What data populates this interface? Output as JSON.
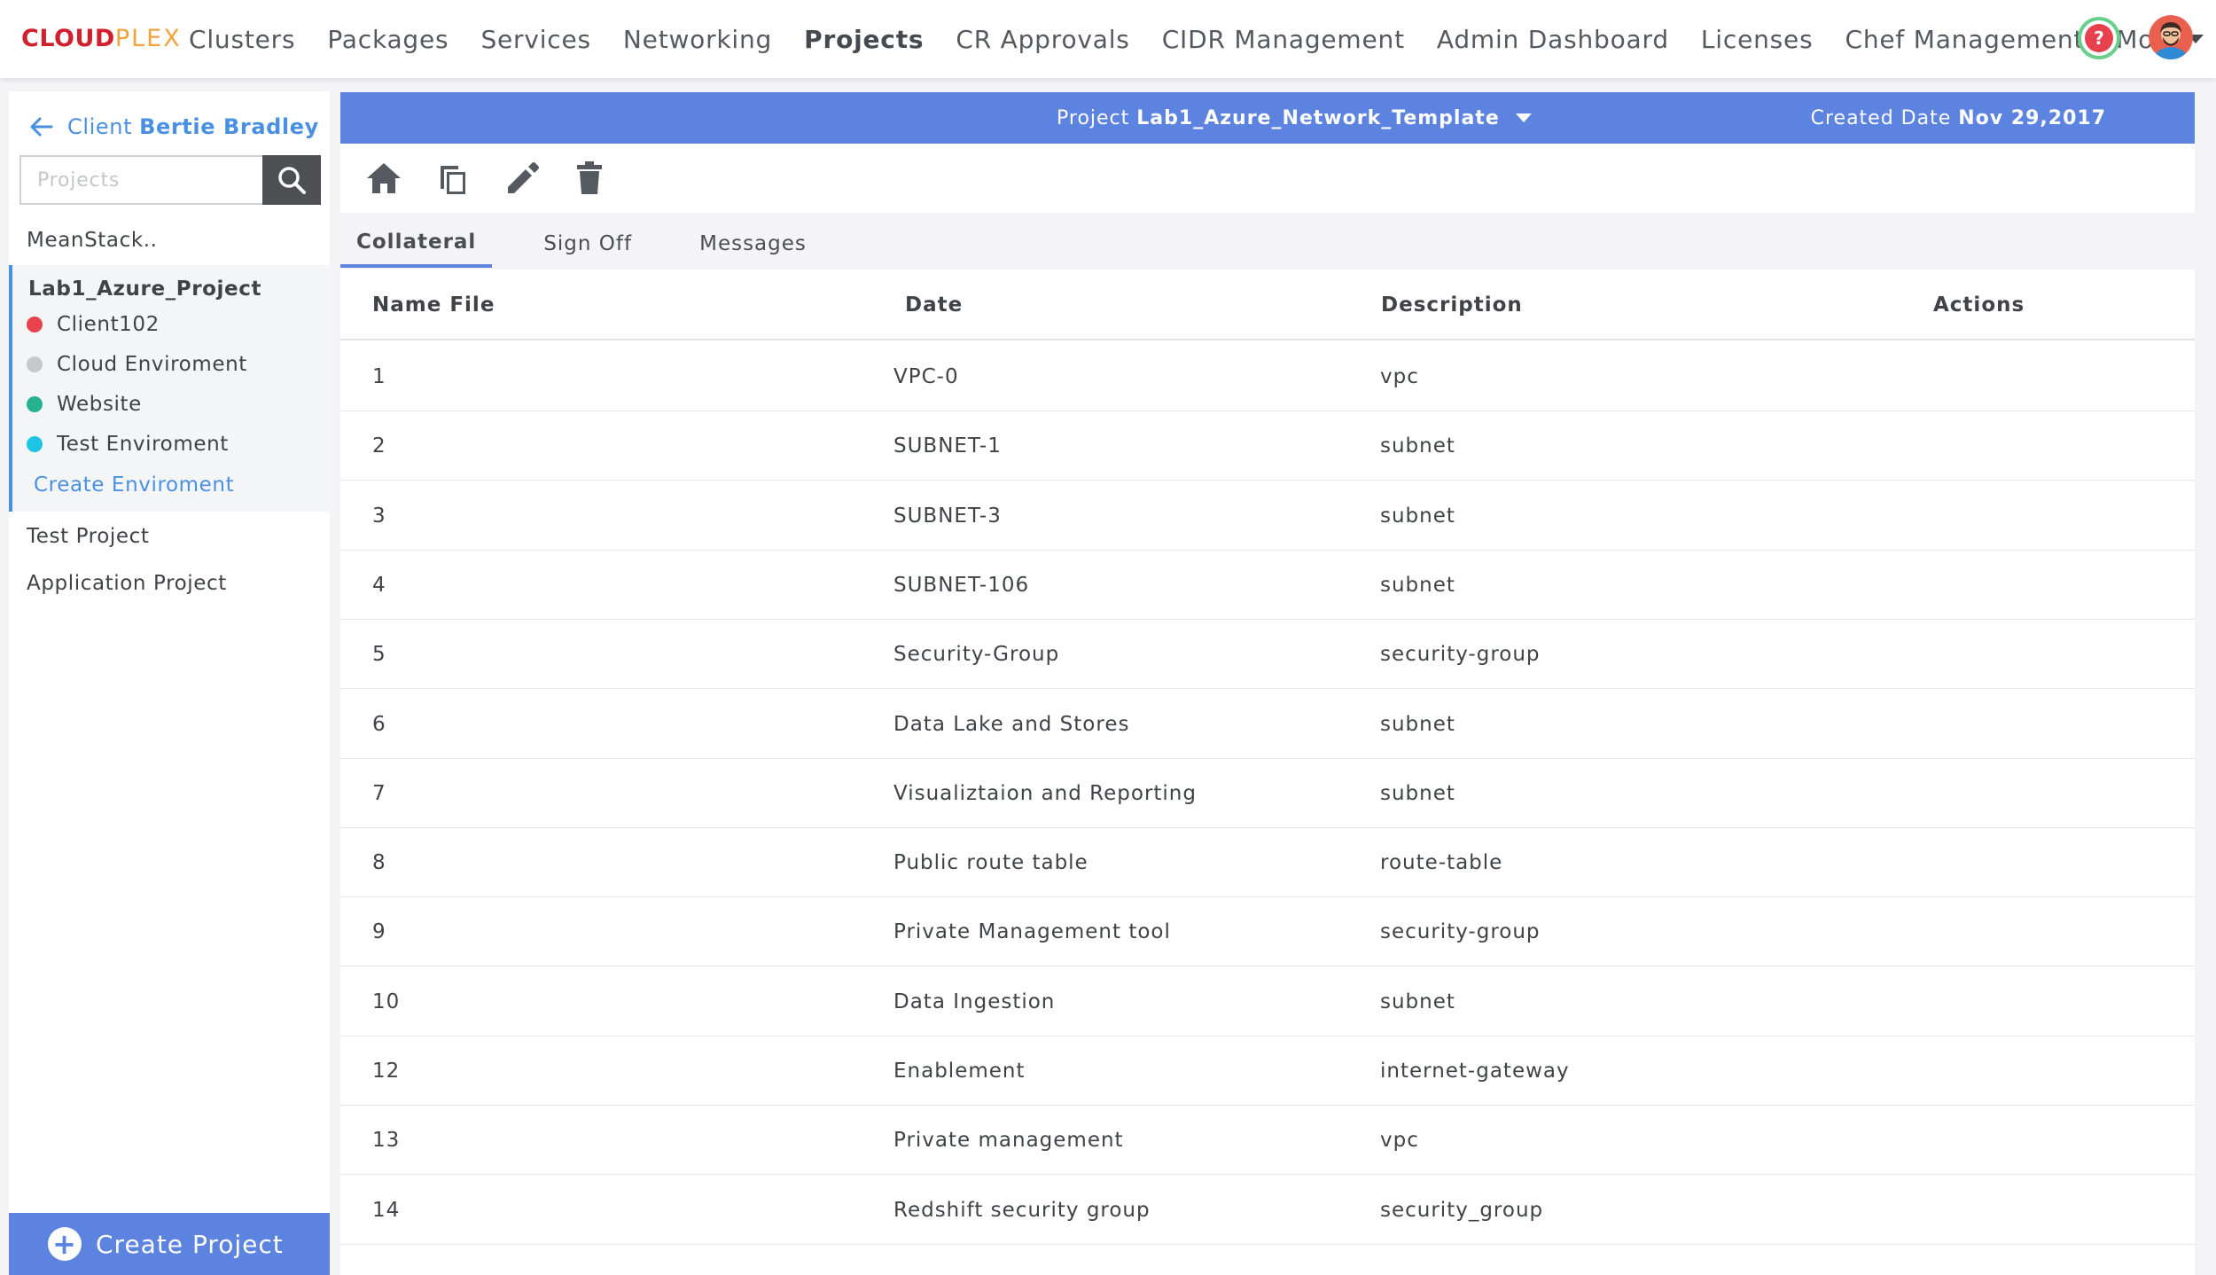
{
  "brand": {
    "logo_part1": "CLOUD",
    "logo_part2": "PLEX"
  },
  "nav": {
    "items": [
      "Clusters",
      "Packages",
      "Services",
      "Networking",
      "Projects",
      "CR Approvals",
      "CIDR Management",
      "Admin Dashboard",
      "Licenses",
      "Chef Management"
    ],
    "active": "Projects",
    "more_label": "More",
    "help_glyph": "?"
  },
  "sidebar": {
    "client_label": "Client",
    "client_name": "Bertie Bradley",
    "search_placeholder": "Projects",
    "projects_top": [
      "MeanStack.."
    ],
    "active_project": "Lab1_Azure_Project",
    "environments": [
      {
        "label": "Client102",
        "color": "#e8434d"
      },
      {
        "label": "Cloud Enviroment",
        "color": "#c7c8cb"
      },
      {
        "label": "Website",
        "color": "#24b28f"
      },
      {
        "label": "Test Enviroment",
        "color": "#1dc4e3"
      }
    ],
    "create_environment": "Create Enviroment",
    "projects_bottom": [
      "Test Project",
      "Application Project"
    ],
    "create_project": "Create Project"
  },
  "project_bar": {
    "project_label": "Project",
    "project_name": "Lab1_Azure_Network_Template",
    "created_label": "Created Date",
    "created_date": "Nov 29,2017",
    "accent": "#5c83e0"
  },
  "toolbar": {
    "icons": [
      "home-icon",
      "copy-icon",
      "edit-icon",
      "delete-icon"
    ]
  },
  "tabs": {
    "items": [
      "Collateral",
      "Sign Off",
      "Messages"
    ],
    "active": "Collateral"
  },
  "table": {
    "headers": [
      "Name File",
      "Date",
      "Description",
      "Actions"
    ],
    "rows": [
      [
        "1",
        "VPC-0",
        "vpc"
      ],
      [
        "2",
        "SUBNET-1",
        "subnet"
      ],
      [
        "3",
        "SUBNET-3",
        "subnet"
      ],
      [
        "4",
        "SUBNET-106",
        "subnet"
      ],
      [
        "5",
        "Security-Group",
        "security-group"
      ],
      [
        "6",
        "Data Lake and Stores",
        "subnet"
      ],
      [
        "7",
        "Visualiztaion and Reporting",
        "subnet"
      ],
      [
        "8",
        "Public route table",
        "route-table"
      ],
      [
        "9",
        "Private Management tool",
        "security-group"
      ],
      [
        "10",
        "Data Ingestion",
        "subnet"
      ],
      [
        "12",
        "Enablement",
        "internet-gateway"
      ],
      [
        "13",
        "Private management",
        "vpc"
      ],
      [
        "14",
        "Redshift security group",
        "security_group"
      ]
    ]
  }
}
